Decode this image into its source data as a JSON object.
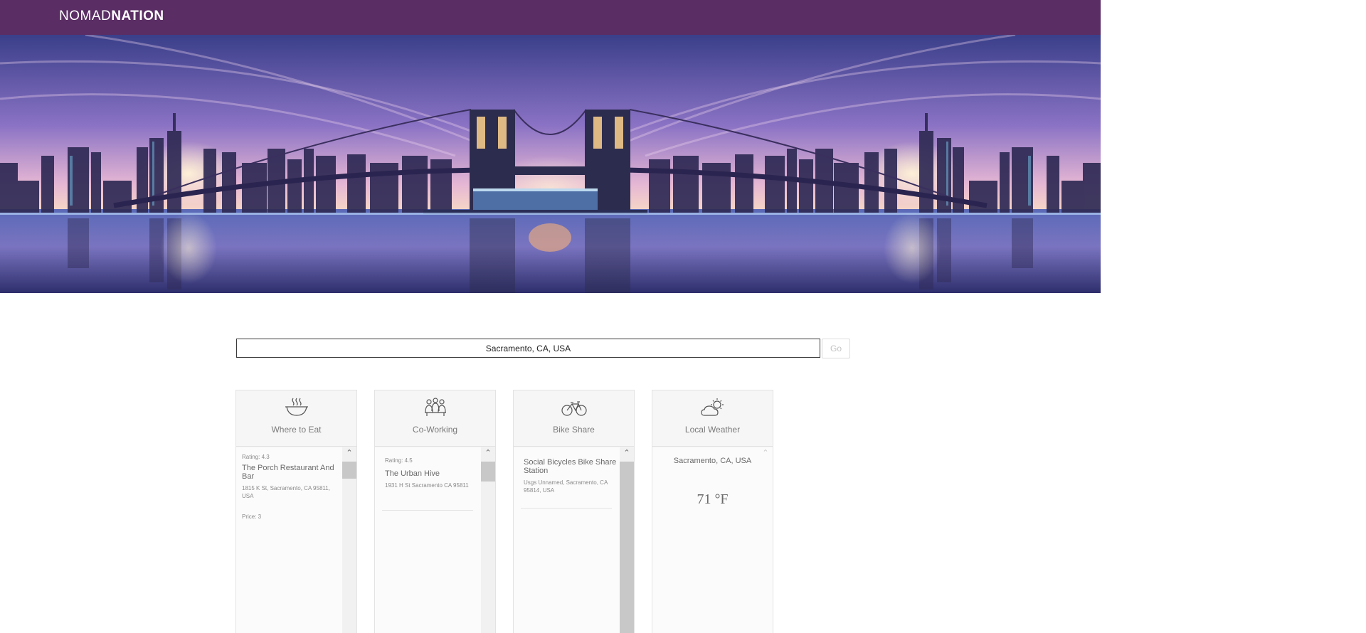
{
  "brand": {
    "part1": "NOMAD",
    "part2": "NATION"
  },
  "search": {
    "value": "Sacramento, CA, USA",
    "go_label": "Go"
  },
  "cards": {
    "eat": {
      "title": "Where to Eat",
      "icon": "bowl-icon",
      "items": [
        {
          "rating": "Rating: 4.3",
          "name": "The Porch Restaurant And Bar",
          "address": "1815 K St, Sacramento, CA 95811, USA",
          "price": "Price: 3"
        }
      ]
    },
    "cowork": {
      "title": "Co-Working",
      "icon": "people-icon",
      "items": [
        {
          "rating": "Rating: 4.5",
          "name": "The Urban Hive",
          "address": "1931 H St Sacramento CA 95811"
        }
      ]
    },
    "bike": {
      "title": "Bike Share",
      "icon": "bicycle-icon",
      "items": [
        {
          "name": "Social Bicycles Bike Share Station",
          "address": "Usgs Unnamed, Sacramento, CA 95814, USA"
        }
      ]
    },
    "weather": {
      "title": "Local Weather",
      "icon": "cloud-sun-icon",
      "city": "Sacramento, CA, USA",
      "temperature": "71 °F"
    }
  },
  "colors": {
    "navbar": "#5a2e64",
    "accent_text": "#7a7a7a"
  }
}
